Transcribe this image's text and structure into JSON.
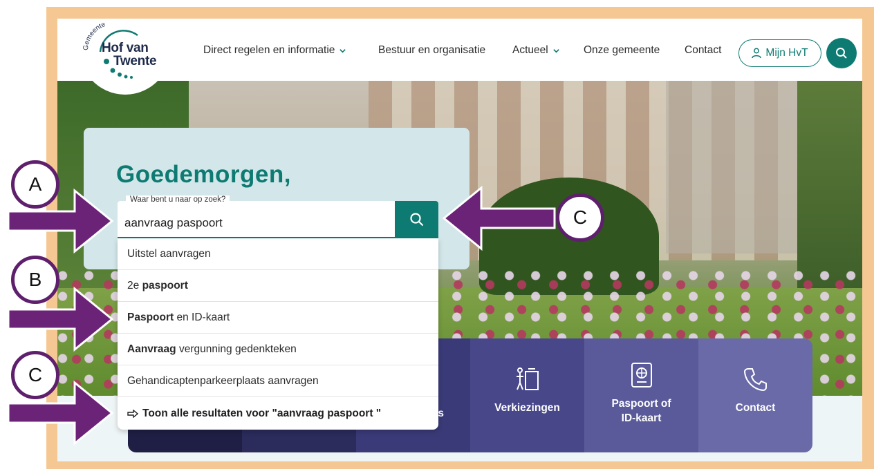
{
  "colors": {
    "brand": "#0e7b73",
    "navy": "#1e2a4a",
    "frame": "#f5c893",
    "annotation": "#5e1f6c"
  },
  "logo": {
    "small_text": "Gemeente",
    "line1": "Hof van",
    "line2": "Twente"
  },
  "nav": {
    "items": [
      {
        "label": "Direct regelen en informatie",
        "has_dropdown": true
      },
      {
        "label": "Bestuur en organisatie",
        "has_dropdown": false
      },
      {
        "label": "Actueel",
        "has_dropdown": true
      },
      {
        "label": "Onze gemeente",
        "has_dropdown": false
      },
      {
        "label": "Contact",
        "has_dropdown": false
      }
    ],
    "account_label": "Mijn HvT",
    "account_icon": "user-icon",
    "search_icon": "search-icon"
  },
  "hero": {
    "greeting": "Goedemorgen,"
  },
  "search": {
    "label": "Waar bent u naar op zoek?",
    "value": "aanvraag paspoort",
    "button_icon": "search-icon"
  },
  "suggestions": [
    {
      "bold": "",
      "rest": "Uitstel aanvragen"
    },
    {
      "pre": "2e ",
      "bold": "paspoort"
    },
    {
      "bold": "Paspoort",
      "rest": " en ID-kaart"
    },
    {
      "bold": "Aanvraag",
      "rest": " vergunning gedenkteken"
    },
    {
      "bold": "",
      "rest": "Gehandicaptenparkeerplaats aanvragen"
    }
  ],
  "show_all": {
    "label": "Toon alle resultaten voor \"aanvraag paspoort \"",
    "icon": "arrow-right-icon"
  },
  "tiles": [
    {
      "label": "",
      "color": "#1f1f45"
    },
    {
      "label": "",
      "color": "#2b2b5c"
    },
    {
      "label": "s",
      "color": "#3a3a78"
    },
    {
      "label": "Verkiezingen",
      "color": "#47478a",
      "icon": "voting-booth-icon"
    },
    {
      "label": "Paspoort of ID-kaart",
      "color": "#5a5a9a",
      "icon": "passport-icon"
    },
    {
      "label": "Contact",
      "color": "#6a6aa8",
      "icon": "phone-icon"
    }
  ],
  "annotations": {
    "a": "A",
    "b": "B",
    "c1": "C",
    "c2": "C"
  }
}
